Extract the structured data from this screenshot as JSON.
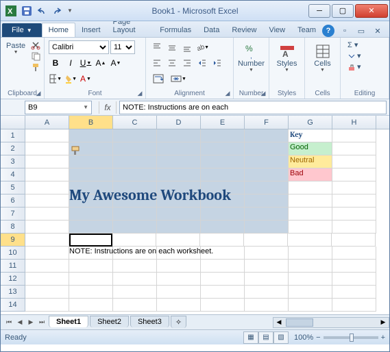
{
  "window": {
    "title": "Book1 - Microsoft Excel"
  },
  "qat": {
    "save": "save-icon",
    "undo": "undo-icon",
    "redo": "redo-icon"
  },
  "tabs": {
    "file": "File",
    "items": [
      "Home",
      "Insert",
      "Page Layout",
      "Formulas",
      "Data",
      "Review",
      "View",
      "Team"
    ],
    "active": "Home"
  },
  "ribbon": {
    "clipboard": {
      "label": "Clipboard",
      "paste": "Paste"
    },
    "font": {
      "label": "Font",
      "name": "Calibri",
      "size": "11",
      "bold": "B",
      "italic": "I",
      "underline": "U"
    },
    "alignment": {
      "label": "Alignment"
    },
    "number": {
      "label": "Number",
      "btn": "Number"
    },
    "styles": {
      "label": "Styles",
      "btn": "Styles"
    },
    "cells": {
      "label": "Cells",
      "btn": "Cells"
    },
    "editing": {
      "label": "Editing"
    }
  },
  "namebox": "B9",
  "formula": "NOTE: Instructions are on each",
  "columns": [
    "A",
    "B",
    "C",
    "D",
    "E",
    "F",
    "G",
    "H"
  ],
  "rows": [
    1,
    2,
    3,
    4,
    5,
    6,
    7,
    8,
    9,
    10,
    11,
    12,
    13,
    14
  ],
  "workbook": {
    "title": "My Awesome Workbook",
    "note": "NOTE: Instructions are on each worksheet.",
    "key_header": "Key",
    "key_items": [
      {
        "label": "Good",
        "class": "good"
      },
      {
        "label": "Neutral",
        "class": "neutral"
      },
      {
        "label": "Bad",
        "class": "bad"
      }
    ]
  },
  "sheets": {
    "items": [
      "Sheet1",
      "Sheet2",
      "Sheet3"
    ],
    "active": "Sheet1"
  },
  "status": {
    "ready": "Ready",
    "zoom": "100%"
  }
}
